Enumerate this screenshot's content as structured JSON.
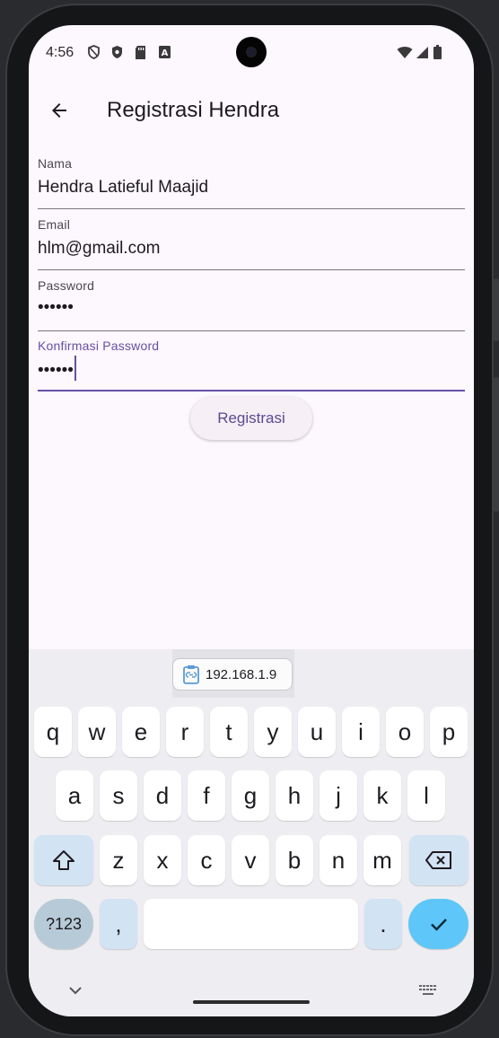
{
  "status_bar": {
    "time": "4:56",
    "icons": [
      "shield-outline-icon",
      "shield-check-icon",
      "sd-card-icon",
      "autofill-a-icon"
    ],
    "right_icons": [
      "wifi-icon",
      "signal-icon",
      "battery-icon"
    ]
  },
  "app_bar": {
    "title": "Registrasi Hendra",
    "back_icon": "arrow-back-icon"
  },
  "form": {
    "nama": {
      "label": "Nama",
      "value": "Hendra Latieful Maajid"
    },
    "email": {
      "label": "Email",
      "value": "hlm@gmail.com"
    },
    "password": {
      "label": "Password",
      "value": "••••••"
    },
    "konfirmasi": {
      "label": "Konfirmasi Password",
      "value": "••••••"
    },
    "submit_label": "Registrasi"
  },
  "keyboard": {
    "clipboard_suggestion": "192.168.1.9",
    "row1": [
      "q",
      "w",
      "e",
      "r",
      "t",
      "y",
      "u",
      "i",
      "o",
      "p"
    ],
    "row2": [
      "a",
      "s",
      "d",
      "f",
      "g",
      "h",
      "j",
      "k",
      "l"
    ],
    "row3": [
      "z",
      "x",
      "c",
      "v",
      "b",
      "n",
      "m"
    ],
    "symbols_label": "?123",
    "comma": ",",
    "period": "."
  },
  "colors": {
    "accent": "#6750a4",
    "screen_bg": "#fdf7fe",
    "keyboard_bg": "#eeedf1",
    "enter_key": "#5ec6f8"
  }
}
